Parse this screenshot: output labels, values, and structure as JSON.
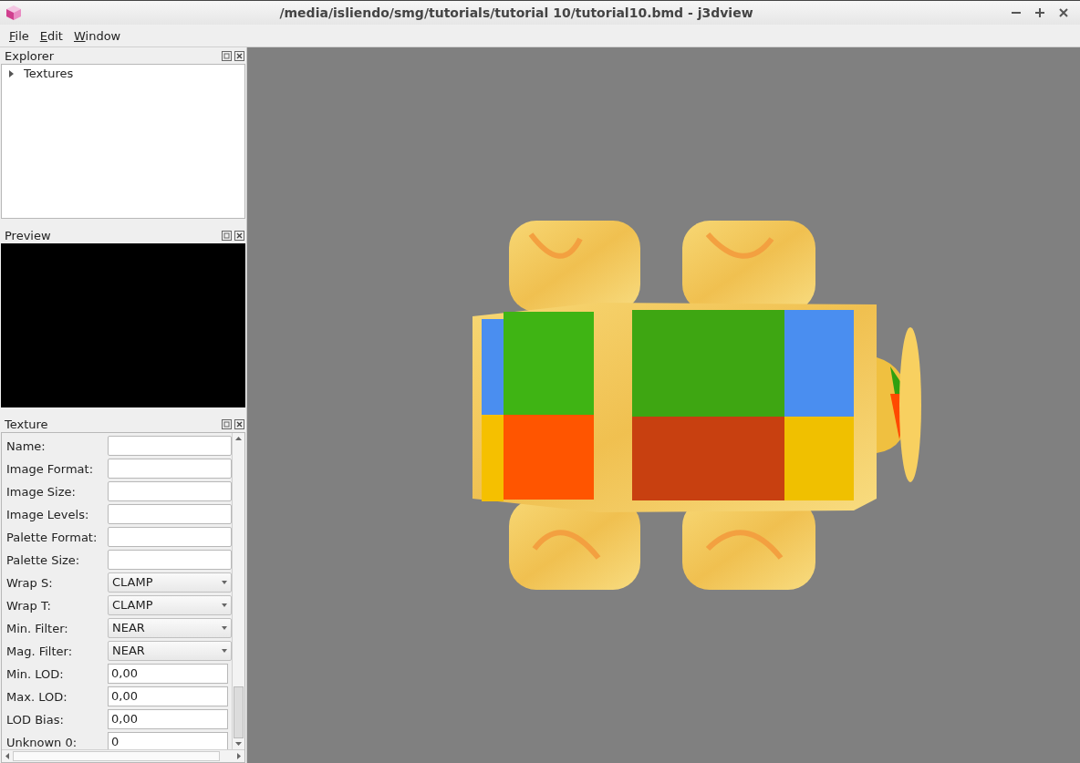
{
  "window": {
    "title": "/media/isliendo/smg/tutorials/tutorial 10/tutorial10.bmd - j3dview"
  },
  "menu": [
    "File",
    "Edit",
    "Window"
  ],
  "explorer": {
    "title": "Explorer",
    "items": [
      {
        "label": "Textures",
        "expanded": false
      }
    ]
  },
  "preview": {
    "title": "Preview"
  },
  "texture": {
    "title": "Texture",
    "fields": [
      {
        "kind": "text",
        "label": "Name:"
      },
      {
        "kind": "text",
        "label": "Image Format:"
      },
      {
        "kind": "text",
        "label": "Image Size:"
      },
      {
        "kind": "text",
        "label": "Image Levels:"
      },
      {
        "kind": "text",
        "label": "Palette Format:"
      },
      {
        "kind": "text",
        "label": "Palette Size:"
      },
      {
        "kind": "combo",
        "label": "Wrap S:",
        "value": "CLAMP"
      },
      {
        "kind": "combo",
        "label": "Wrap T:",
        "value": "CLAMP"
      },
      {
        "kind": "combo",
        "label": "Min. Filter:",
        "value": "NEAR"
      },
      {
        "kind": "combo",
        "label": "Mag. Filter:",
        "value": "NEAR"
      },
      {
        "kind": "spin",
        "label": "Min. LOD:",
        "value": "0,00"
      },
      {
        "kind": "spin",
        "label": "Max. LOD:",
        "value": "0,00"
      },
      {
        "kind": "spin",
        "label": "LOD Bias:",
        "value": "0,00"
      },
      {
        "kind": "spin",
        "label": "Unknown 0:",
        "value": "0"
      }
    ]
  }
}
